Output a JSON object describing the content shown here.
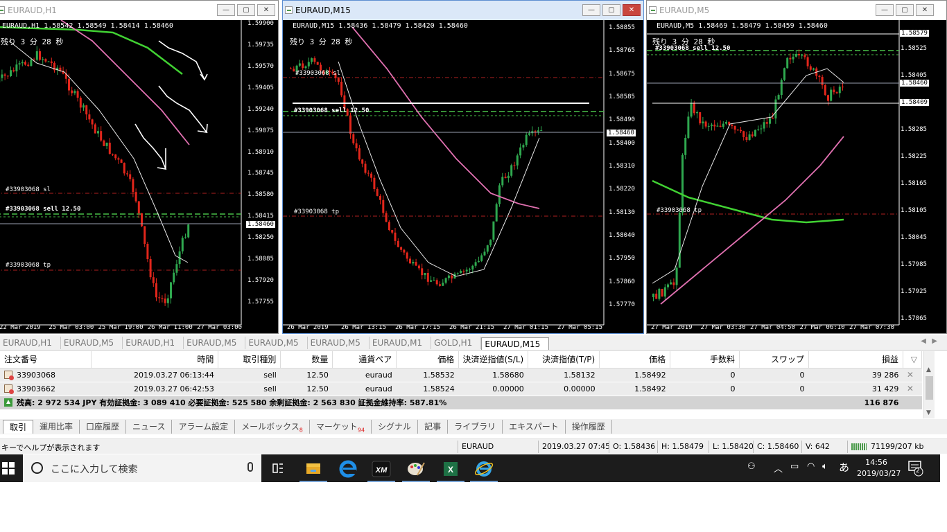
{
  "windows": [
    {
      "title": "EURAUD,H1",
      "ohlc": "EURAUD,H1  1.58542 1.58549 1.58414 1.58460",
      "timer": "残り 3 分 28 秒",
      "ticks": [
        "1.59900",
        "1.59735",
        "1.59570",
        "1.59405",
        "1.59240",
        "1.59075",
        "1.58910",
        "1.58745",
        "1.58580",
        "1.58415",
        "1.58250",
        "1.58085",
        "1.57920",
        "1.57755"
      ],
      "price": "1.58460",
      "labels": [
        "#33903068 sl",
        "#33903068 sell 12.50",
        "#33903068 tp"
      ],
      "times": [
        "22 Mar 2019",
        "25 Mar 03:00",
        "25 Mar 19:00",
        "26 Mar 11:00",
        "27 Mar 03:00"
      ]
    },
    {
      "title": "EURAUD,M15",
      "ohlc": "EURAUD,M15  1.58436 1.58479 1.58420 1.58460",
      "timer": "残り 3 分 28 秒",
      "ticks": [
        "1.58855",
        "1.58765",
        "1.58675",
        "1.58585",
        "1.58490",
        "1.58400",
        "1.58310",
        "1.58220",
        "1.58130",
        "1.58040",
        "1.57950",
        "1.57860",
        "1.57770"
      ],
      "price": "1.58460",
      "labels": [
        "#33903068 sl",
        "#33903068 sell 12.50",
        "#33903068 tp"
      ],
      "times": [
        "26 Mar 2019",
        "26 Mar 13:15",
        "26 Mar 17:15",
        "26 Mar 21:15",
        "27 Mar 01:15",
        "27 Mar 05:15"
      ]
    },
    {
      "title": "EURAUD,M5",
      "ohlc": "EURAUD,M5  1.58469 1.58479 1.58459 1.58460",
      "timer": "残り 3 分 28 秒",
      "ticks": [
        "1.58525",
        "1.58405",
        "1.58345",
        "1.58285",
        "1.58225",
        "1.58165",
        "1.58105",
        "1.58045",
        "1.57985",
        "1.57925",
        "1.57865"
      ],
      "price": "1.58460",
      "price_high": "1.58579",
      "price_bid": "1.58409",
      "labels": [
        "#33903068 sell 12.50",
        "#33903068 tp"
      ],
      "times": [
        "27 Mar 2019",
        "27 Mar 03:30",
        "27 Mar 04:50",
        "27 Mar 06:10",
        "27 Mar 07:30"
      ]
    }
  ],
  "chart_tabs": [
    "EURAUD,H1",
    "EURAUD,M5",
    "EURAUD,H1",
    "EURAUD,M5",
    "EURAUD,M5",
    "EURAUD,M5",
    "EURAUD,M1",
    "GOLD,H1",
    "EURAUD,M15"
  ],
  "trade": {
    "headers": [
      "注文番号",
      "時間",
      "取引種別",
      "数量",
      "通貨ペア",
      "価格",
      "決済逆指値(S/L)",
      "決済指値(T/P)",
      "価格",
      "手数料",
      "スワップ",
      "損益"
    ],
    "rows": [
      [
        "33903068",
        "2019.03.27 06:13:44",
        "sell",
        "12.50",
        "euraud",
        "1.58532",
        "1.58680",
        "1.58132",
        "1.58492",
        "0",
        "0",
        "39 286"
      ],
      [
        "33903662",
        "2019.03.27 06:42:53",
        "sell",
        "12.50",
        "euraud",
        "1.58524",
        "0.00000",
        "0.00000",
        "1.58492",
        "0",
        "0",
        "31 429"
      ]
    ],
    "total_label": "残高: 2 972 534 JPY  有効証拠金: 3 089 410  必要証拠金: 525 580  余剰証拠金: 2 563 830  証拠金維持率: 587.81%",
    "total_value": "116 876"
  },
  "term_tabs": [
    {
      "label": "取引",
      "badge": ""
    },
    {
      "label": "運用比率",
      "badge": ""
    },
    {
      "label": "口座履歴",
      "badge": ""
    },
    {
      "label": "ニュース",
      "badge": ""
    },
    {
      "label": "アラーム設定",
      "badge": ""
    },
    {
      "label": "メールボックス",
      "badge": "8"
    },
    {
      "label": "マーケット",
      "badge": "94"
    },
    {
      "label": "シグナル",
      "badge": ""
    },
    {
      "label": "記事",
      "badge": ""
    },
    {
      "label": "ライブラリ",
      "badge": ""
    },
    {
      "label": "エキスパート",
      "badge": ""
    },
    {
      "label": "操作履歴",
      "badge": ""
    }
  ],
  "status": {
    "help": "キーでヘルプが表示されます",
    "symbol": "EURAUD",
    "time": "2019.03.27 07:45",
    "open": "O: 1.58436",
    "high": "H: 1.58479",
    "low": "L: 1.58420",
    "close": "C: 1.58460",
    "volume": "V: 642",
    "traffic": "71199/207 kb"
  },
  "taskbar": {
    "search_placeholder": "ここに入力して検索",
    "ime": "あ",
    "time": "14:56",
    "date": "2019/03/27",
    "notif_count": "2",
    "xm_label": "XM"
  },
  "colors": {
    "bull": "#2fa84f",
    "bear": "#e2261b",
    "ma_slow": "#41d233",
    "ma_mid": "#e070b0",
    "ma_fast": "#e8e8e8",
    "level": "#b02020",
    "order": "#48c048"
  }
}
